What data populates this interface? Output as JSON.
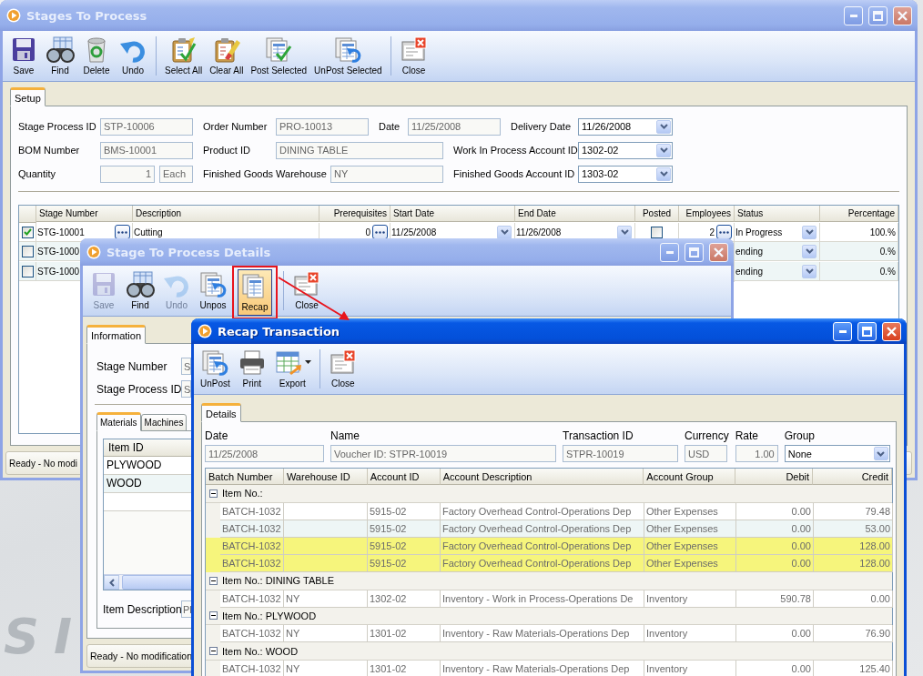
{
  "desktop": {
    "wallpaper_text": "SI"
  },
  "main_window": {
    "title": "Stages To Process",
    "active": false,
    "toolbar": [
      [
        {
          "kind": "save",
          "label": "Save"
        },
        {
          "kind": "find",
          "label": "Find"
        },
        {
          "kind": "delete",
          "label": "Delete"
        },
        {
          "kind": "undo",
          "label": "Undo"
        }
      ],
      [
        {
          "kind": "select-all",
          "label": "Select All"
        },
        {
          "kind": "clear-all",
          "label": "Clear All"
        },
        {
          "kind": "post",
          "label": "Post Selected"
        },
        {
          "kind": "unpost",
          "label": "UnPost Selected"
        }
      ],
      [
        {
          "kind": "close",
          "label": "Close"
        }
      ]
    ],
    "tabs": [
      {
        "label": "Setup",
        "selected": true
      }
    ],
    "form": [
      [
        {
          "label": "Stage Process ID",
          "value": "STP-10006",
          "kind": "readonly"
        },
        {
          "label": "Order Number",
          "value": "PRO-10013",
          "kind": "readonly"
        },
        {
          "label": "Date",
          "value": "11/25/2008",
          "kind": "readonly"
        },
        {
          "label": "Delivery Date",
          "value": "11/26/2008",
          "kind": "dropdown"
        }
      ],
      [
        {
          "label": "BOM Number",
          "value": "BMS-10001",
          "kind": "readonly"
        },
        {
          "label": "Product ID",
          "value": "DINING TABLE",
          "kind": "wide"
        },
        {
          "label": "Work In Process Account ID",
          "value": "1302-02",
          "kind": "dropdown"
        }
      ],
      [
        {
          "label": "Quantity",
          "value": "1",
          "unit": "Each",
          "kind": "quantity"
        },
        {
          "label": "Finished Goods Warehouse",
          "value": "NY",
          "kind": "wide"
        },
        {
          "label": "Finished Goods Account ID",
          "value": "1303-02",
          "kind": "dropdown"
        }
      ]
    ],
    "grid": {
      "columns": [
        "Stage Number",
        "Description",
        "Prerequisites",
        "Start Date",
        "End Date",
        "Posted",
        "Employees",
        "Status",
        "Percentage"
      ],
      "rows": [
        {
          "checked": true,
          "stage_number": "STG-10001",
          "description": "Cutting",
          "prerequisites": "0",
          "start_date": "11/25/2008",
          "end_date": "11/26/2008",
          "posted": false,
          "employees": "2",
          "status": "In Progress",
          "percentage": "100.%"
        },
        {
          "checked": false,
          "stage_number": "STG-1000",
          "status": "ending",
          "percentage": "0.%"
        },
        {
          "checked": false,
          "stage_number": "STG-1000",
          "status": "ending",
          "percentage": "0.%"
        }
      ]
    },
    "status_bar": "Ready - No modi"
  },
  "details_window": {
    "title": "Stage To Process Details",
    "active": false,
    "toolbar": [
      [
        {
          "kind": "save",
          "label": "Save",
          "disabled": true,
          "pressed": false
        },
        {
          "kind": "find",
          "label": "Find",
          "disabled": false,
          "pressed": false
        },
        {
          "kind": "undo",
          "label": "Undo",
          "disabled": true,
          "pressed": false
        },
        {
          "kind": "unpost",
          "label": "Unpos",
          "disabled": false,
          "pressed": false
        },
        {
          "kind": "recap",
          "label": "Recap",
          "disabled": false,
          "pressed": true
        }
      ],
      [
        {
          "kind": "close",
          "label": "Close",
          "disabled": false,
          "pressed": false
        }
      ]
    ],
    "tabs": [
      {
        "label": "Information",
        "selected": true
      }
    ],
    "fields": [
      {
        "label": "Stage Number",
        "value": "S"
      },
      {
        "label": "Stage Process ID",
        "value": "S"
      }
    ],
    "sub_tabs": [
      {
        "label": "Materials",
        "selected": true
      },
      {
        "label": "Machines",
        "selected": false
      }
    ],
    "materials": {
      "columns": [
        "Item ID"
      ],
      "rows": [
        "PLYWOOD",
        "WOOD"
      ]
    },
    "item_description": {
      "label": "Item Description",
      "value": "Pl"
    },
    "status_bar": "Ready - No modification"
  },
  "recap_window": {
    "title": "Recap Transaction",
    "active": true,
    "toolbar": [
      [
        {
          "kind": "unpost",
          "label": "UnPost"
        },
        {
          "kind": "print",
          "label": "Print"
        },
        {
          "kind": "export",
          "label": "Export",
          "menu": true
        }
      ],
      [
        {
          "kind": "close",
          "label": "Close"
        }
      ]
    ],
    "tabs": [
      {
        "label": "Details",
        "selected": true
      }
    ],
    "fields": [
      {
        "label": "Date",
        "value": "11/25/2008",
        "kind": "readonly"
      },
      {
        "label": "Name",
        "value": "Voucher ID: STPR-10019",
        "kind": "readonly"
      },
      {
        "label": "Transaction ID",
        "value": "STPR-10019",
        "kind": "readonly"
      },
      {
        "label": "Currency",
        "value": "USD",
        "kind": "readonly"
      },
      {
        "label": "Rate",
        "value": "1.00",
        "kind": "number"
      },
      {
        "label": "Group",
        "value": "None",
        "kind": "dropdown"
      }
    ],
    "grid": {
      "columns": [
        "Batch Number",
        "Warehouse ID",
        "Account ID",
        "Account Description",
        "Account Group",
        "Debit",
        "Credit"
      ],
      "groups": [
        {
          "label": "Item No.:",
          "expanded": true,
          "rows": [
            {
              "highlighted": false,
              "cells": [
                "BATCH-1032",
                null,
                "5915-02",
                "Factory Overhead Control-Operations Dep",
                "Other Expenses",
                "0.00",
                "79.48"
              ]
            },
            {
              "highlighted": false,
              "cells": [
                "BATCH-1032",
                null,
                "5915-02",
                "Factory Overhead Control-Operations Dep",
                "Other Expenses",
                "0.00",
                "53.00"
              ]
            },
            {
              "highlighted": true,
              "cells": [
                "BATCH-1032",
                null,
                "5915-02",
                "Factory Overhead Control-Operations Dep",
                "Other Expenses",
                "0.00",
                "128.00"
              ]
            },
            {
              "highlighted": true,
              "cells": [
                "BATCH-1032",
                null,
                "5915-02",
                "Factory Overhead Control-Operations Dep",
                "Other Expenses",
                "0.00",
                "128.00"
              ]
            }
          ]
        },
        {
          "label": "Item No.: DINING TABLE",
          "expanded": true,
          "rows": [
            {
              "highlighted": false,
              "cells": [
                "BATCH-1032",
                "NY",
                "1302-02",
                "Inventory - Work in Process-Operations De",
                "Inventory",
                "590.78",
                "0.00"
              ]
            }
          ]
        },
        {
          "label": "Item No.: PLYWOOD",
          "expanded": true,
          "rows": [
            {
              "highlighted": false,
              "cells": [
                "BATCH-1032",
                "NY",
                "1301-02",
                "Inventory - Raw Materials-Operations Dep",
                "Inventory",
                "0.00",
                "76.90"
              ]
            }
          ]
        },
        {
          "label": "Item No.: WOOD",
          "expanded": true,
          "rows": [
            {
              "highlighted": false,
              "cells": [
                "BATCH-1032",
                "NY",
                "1301-02",
                "Inventory - Raw Materials-Operations Dep",
                "Inventory",
                "0.00",
                "125.40"
              ]
            }
          ]
        }
      ]
    }
  }
}
